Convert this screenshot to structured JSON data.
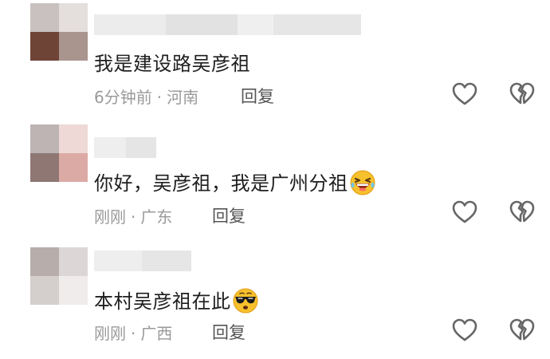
{
  "comments": [
    {
      "text": "我是建设路吴彦祖",
      "time": "6分钟前",
      "separator": "·",
      "location": "河南",
      "reply_label": "回复",
      "emoji": ""
    },
    {
      "text": "你好，吴彦祖，我是广州分祖",
      "time": "刚刚",
      "separator": "·",
      "location": "广东",
      "reply_label": "回复",
      "emoji": "laughing-emoji"
    },
    {
      "text": "本村吴彦祖在此",
      "time": "刚刚",
      "separator": "·",
      "location": "广西",
      "reply_label": "回复",
      "emoji": "sunglasses-emoji"
    }
  ],
  "icons": {
    "like": "heart-outline-icon",
    "dislike": "broken-heart-icon"
  },
  "colors": {
    "text": "#1e1e1e",
    "meta": "#9a9a9a",
    "icon": "#666666"
  }
}
